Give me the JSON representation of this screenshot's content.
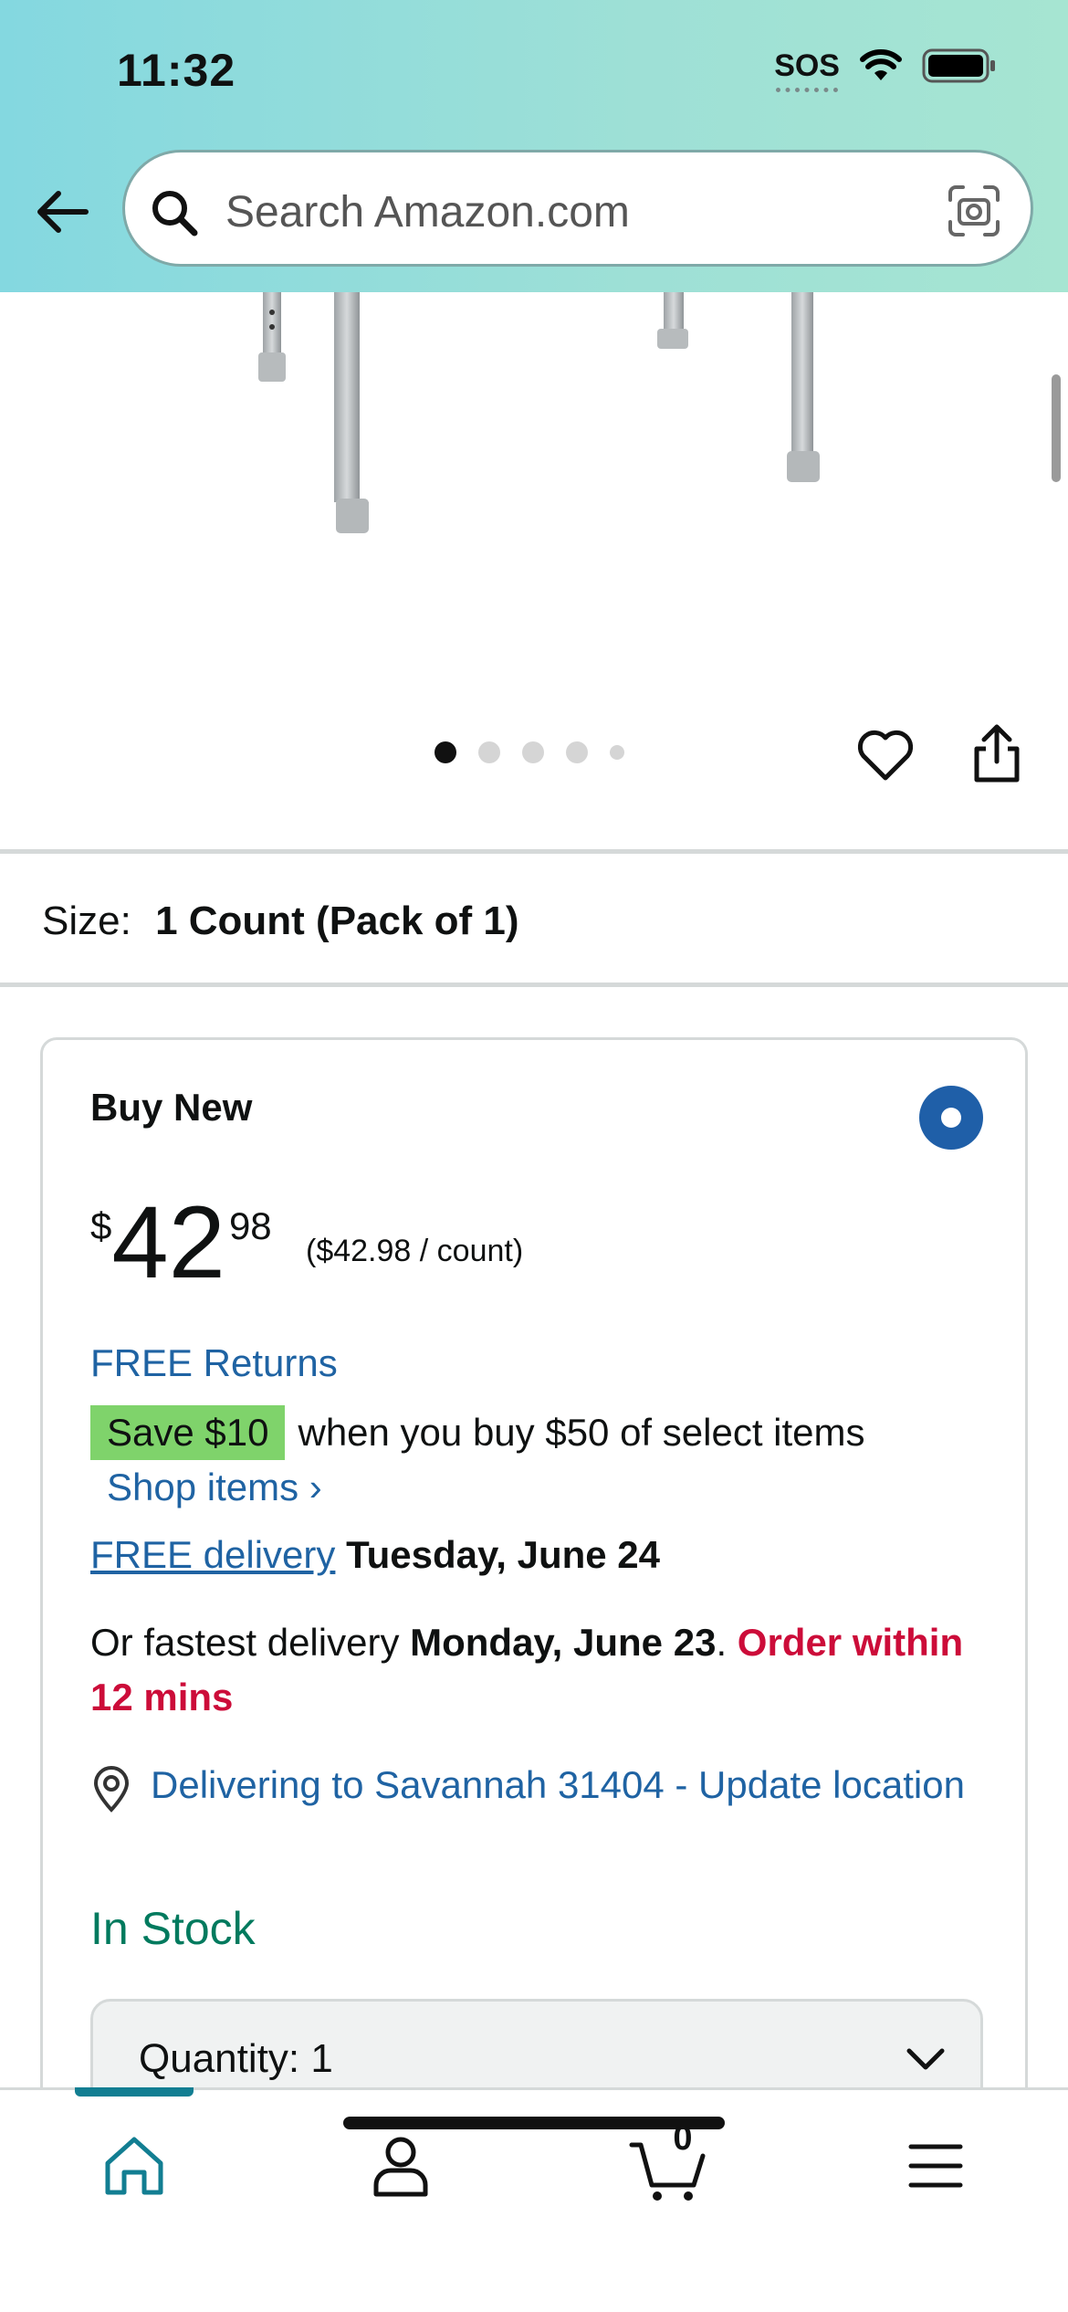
{
  "status_bar": {
    "time": "11:32",
    "sos": "SOS"
  },
  "search": {
    "placeholder": "Search Amazon.com"
  },
  "gallery": {
    "current": 1,
    "total": 5
  },
  "size": {
    "label": "Size:",
    "value": "1 Count (Pack of 1)"
  },
  "buy_new": {
    "title": "Buy New",
    "price_symbol": "$",
    "price_whole": "42",
    "price_fraction": "98",
    "unit_price": "($42.98 / count)",
    "free_returns": "FREE Returns",
    "save_badge": "Save $10",
    "save_text": "when you buy $50 of select items",
    "shop_items": "Shop items ›",
    "free_delivery_link": "FREE delivery",
    "free_delivery_date": "Tuesday, June 24",
    "fastest_prefix": "Or fastest delivery",
    "fastest_date": "Monday, June 23",
    "fastest_period": ".",
    "order_within": "Order within 12 mins",
    "location": "Delivering to Savannah 31404 - Update location",
    "stock": "In Stock",
    "quantity_label": "Quantity:",
    "quantity_value": "1"
  },
  "tab_bar": {
    "cart_count": "0",
    "active": "home"
  },
  "colors": {
    "link": "#1f63a3",
    "stock": "#007a5e",
    "urgent": "#cc0c39",
    "save_badge": "#7fd36b",
    "accent": "#127e92"
  }
}
